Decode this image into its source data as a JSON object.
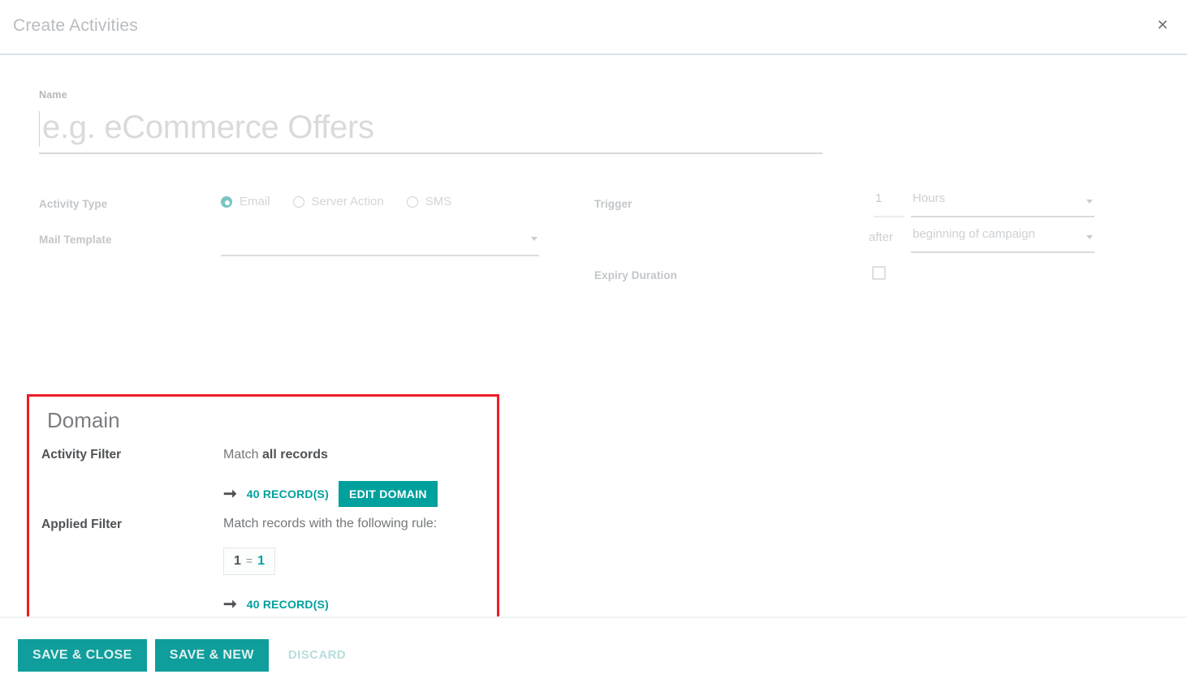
{
  "dialog": {
    "title": "Create Activities",
    "close_label": "×"
  },
  "name_field": {
    "label": "Name",
    "value": "",
    "placeholder": "e.g. eCommerce Offers"
  },
  "activity_type": {
    "label": "Activity Type",
    "options": [
      {
        "label": "Email",
        "selected": true
      },
      {
        "label": "Server Action",
        "selected": false
      },
      {
        "label": "SMS",
        "selected": false
      }
    ]
  },
  "mail_template": {
    "label": "Mail Template",
    "value": "",
    "caret_icon": "chevron-down-icon"
  },
  "trigger": {
    "label": "Trigger",
    "interval_number": "1",
    "interval_unit": "Hours",
    "relative_word": "after",
    "relative_to": "beginning of campaign",
    "unit_caret_icon": "chevron-down-icon",
    "relative_caret_icon": "chevron-down-icon"
  },
  "expiry_duration": {
    "label": "Expiry Duration",
    "checked": false
  },
  "domain": {
    "title": "Domain",
    "activity_filter": {
      "label": "Activity Filter",
      "match_prefix": "Match ",
      "match_value": "all records",
      "arrow_icon": "arrow-right-icon",
      "records_link": "40 RECORD(S)",
      "edit_button": "EDIT DOMAIN"
    },
    "applied_filter": {
      "label": "Applied Filter",
      "description": "Match records with the following rule:",
      "rule": {
        "field": "1",
        "operator": "=",
        "value": "1"
      },
      "arrow_icon": "arrow-right-icon",
      "records_link": "40 RECORD(S)"
    },
    "highlight_color": "#ed1c24"
  },
  "footer": {
    "save_close_label": "SAVE & CLOSE",
    "save_new_label": "SAVE & NEW",
    "discard_label": "DISCARD"
  },
  "colors": {
    "accent_teal": "#00a09d",
    "highlight_red": "#ed1c24"
  }
}
